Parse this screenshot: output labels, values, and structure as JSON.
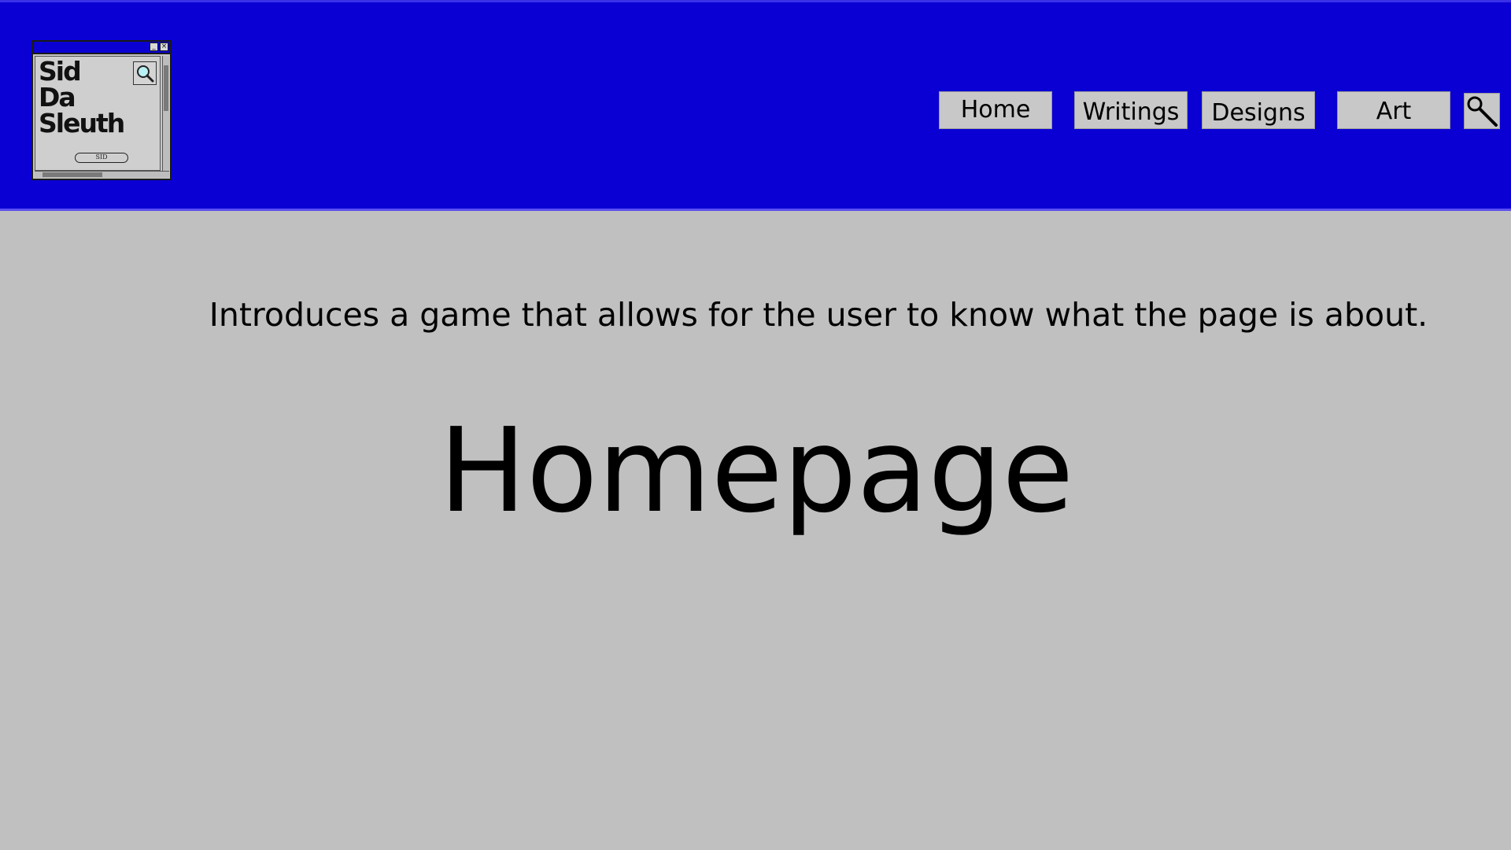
{
  "brand": {
    "logo_lines": [
      "Sid",
      "Da",
      "Sleuth"
    ],
    "logo_badge": "SID",
    "minimize_glyph": "_",
    "close_glyph": "×",
    "logo_icon": "magnifier-icon"
  },
  "nav": {
    "items": [
      {
        "label": "Home"
      },
      {
        "label": "Writings"
      },
      {
        "label": "Designs"
      },
      {
        "label": "Art"
      }
    ],
    "search_icon": "magnifier-icon"
  },
  "main": {
    "intro": "Introduces a game that allows for the user to know what the page is about.",
    "title": "Homepage"
  },
  "colors": {
    "header_bg": "#0a00d4",
    "page_bg": "#c0c0c0",
    "button_bg": "#c8c8c8",
    "text": "#000000"
  }
}
